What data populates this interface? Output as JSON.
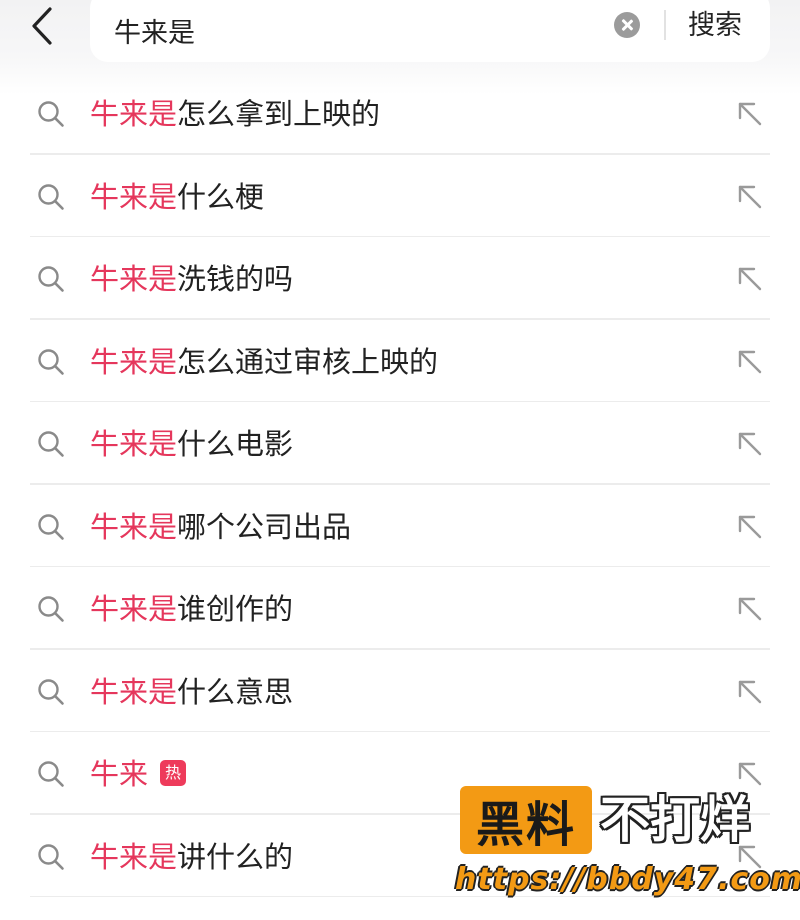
{
  "search": {
    "query": "牛来是",
    "submit_label": "搜索"
  },
  "suggestions": [
    {
      "highlight": "牛来是",
      "rest": "怎么拿到上映的"
    },
    {
      "highlight": "牛来是",
      "rest": "什么梗"
    },
    {
      "highlight": "牛来是",
      "rest": "洗钱的吗"
    },
    {
      "highlight": "牛来是",
      "rest": "怎么通过审核上映的"
    },
    {
      "highlight": "牛来是",
      "rest": "什么电影"
    },
    {
      "highlight": "牛来是",
      "rest": "哪个公司出品"
    },
    {
      "highlight": "牛来是",
      "rest": "谁创作的"
    },
    {
      "highlight": "牛来是",
      "rest": "什么意思"
    },
    {
      "highlight": "牛来",
      "rest": "",
      "badge": "热"
    },
    {
      "highlight": "牛来是",
      "rest": "讲什么的"
    }
  ],
  "watermark": {
    "left_text": "黑料",
    "right_text": "不打烊",
    "url": "https://bbdy47.com"
  },
  "colors": {
    "highlight": "#e5375c",
    "badge": "#ee3b5b",
    "watermark_orange": "#f39a14"
  },
  "icons": {
    "back": "chevron-left-icon",
    "clear": "clear-circle-icon",
    "row": "search-icon",
    "fill": "arrow-up-left-icon"
  }
}
